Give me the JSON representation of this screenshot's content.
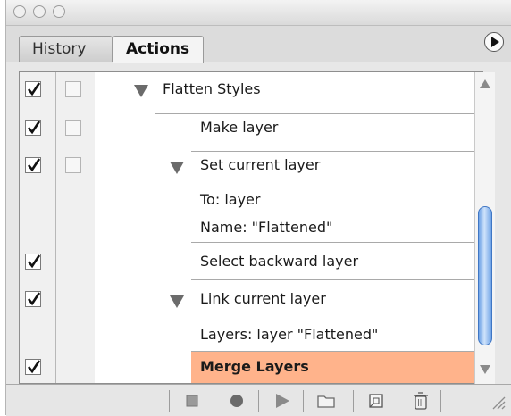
{
  "tabs": {
    "history": "History",
    "actions": "Actions"
  },
  "rows": [
    {
      "label": "Flatten Styles",
      "checked": true,
      "dialog": true,
      "expanded": true
    },
    {
      "label": "Make layer",
      "checked": true,
      "dialog": true
    },
    {
      "label": "Set current layer",
      "checked": true,
      "dialog": true,
      "expanded": true
    },
    {
      "label": "To: layer"
    },
    {
      "label": "Name:  \"Flattened\""
    },
    {
      "label": "Select backward layer",
      "checked": true
    },
    {
      "label": "Link current layer",
      "checked": true,
      "expanded": true
    },
    {
      "label": "Layers: layer \"Flattened\""
    },
    {
      "label": "Merge Layers",
      "checked": true,
      "selected": true
    }
  ],
  "colors": {
    "selection": "#ffb38b",
    "scroll_thumb": "#6fa3e6"
  },
  "toolbar_icons": [
    "stop-icon",
    "record-icon",
    "play-icon",
    "new-set-folder-icon",
    "new-action-icon",
    "trash-icon"
  ]
}
